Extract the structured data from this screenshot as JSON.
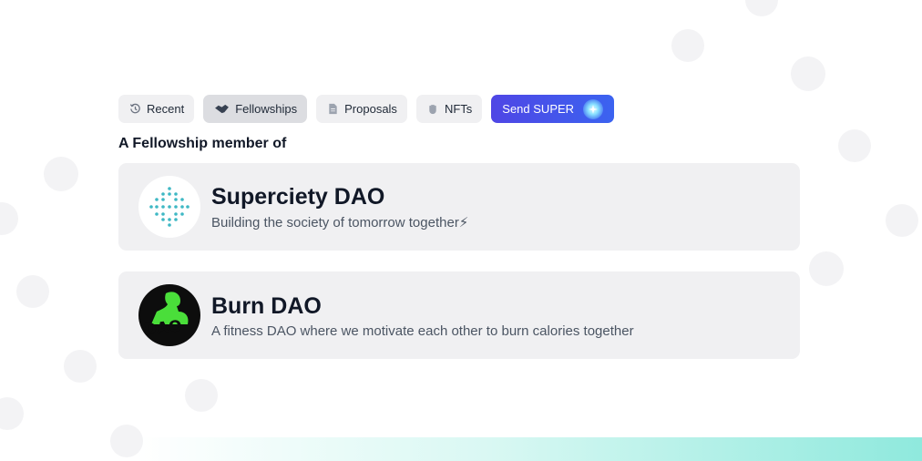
{
  "tabs": [
    {
      "label": "Recent",
      "icon": "history-icon"
    },
    {
      "label": "Fellowships",
      "icon": "handshake-icon"
    },
    {
      "label": "Proposals",
      "icon": "document-icon"
    },
    {
      "label": "NFTs",
      "icon": "hand-icon"
    }
  ],
  "send_button": {
    "label": "Send SUPER",
    "icon": "sparkle-icon"
  },
  "section_title": "A Fellowship member of",
  "fellowships": [
    {
      "name": "Superciety DAO",
      "description": "Building the society of tomorrow together⚡",
      "avatar": "superciety-logo"
    },
    {
      "name": "Burn DAO",
      "description": "A fitness DAO where we motivate each other to burn calories together",
      "avatar": "burn-dao-logo",
      "avatar_text": "DAO"
    }
  ],
  "colors": {
    "accent": "#4f46e5",
    "card_bg": "#f0f0f2",
    "active_tab": "#dcdde1",
    "burn_green": "#4ade3a"
  }
}
